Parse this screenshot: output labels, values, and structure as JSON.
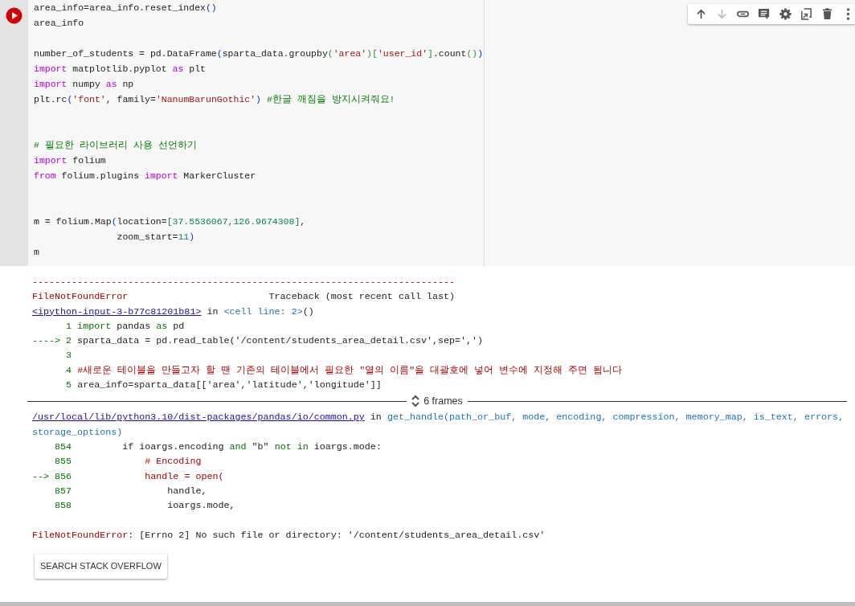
{
  "toolbar": [
    {
      "kind": "up",
      "disabled": false
    },
    {
      "kind": "down",
      "disabled": true
    },
    {
      "kind": "link",
      "disabled": false
    },
    {
      "kind": "comment",
      "disabled": false
    },
    {
      "kind": "settings",
      "disabled": false
    },
    {
      "kind": "mirror",
      "disabled": false
    },
    {
      "kind": "delete",
      "disabled": false
    },
    {
      "kind": "more",
      "disabled": false
    }
  ],
  "code_cell": {
    "lines": [
      {
        "kind": "code",
        "tokens": [
          {
            "text": "area_info=area_info.reset_index",
            "kind": "plain"
          },
          {
            "text": "()",
            "kind": "paren"
          }
        ]
      },
      {
        "kind": "code",
        "tokens": [
          {
            "text": "area_info",
            "kind": "plain"
          }
        ]
      },
      {
        "kind": "blank"
      },
      {
        "kind": "code",
        "tokens": [
          {
            "text": "number_of_students = pd.DataFrame",
            "kind": "plain"
          },
          {
            "text": "(",
            "kind": "paren"
          },
          {
            "text": "sparta_data.groupby",
            "kind": "plain"
          },
          {
            "text": "(",
            "kind": "paren2"
          },
          {
            "text": "'area'",
            "kind": "string"
          },
          {
            "text": ")[",
            "kind": "paren2"
          },
          {
            "text": "'user_id'",
            "kind": "string"
          },
          {
            "text": "]",
            "kind": "paren2"
          },
          {
            "text": ".count",
            "kind": "plain"
          },
          {
            "text": "()",
            "kind": "paren2"
          },
          {
            "text": ")",
            "kind": "paren"
          }
        ]
      },
      {
        "kind": "code",
        "tokens": [
          {
            "text": "import",
            "kind": "keyword"
          },
          {
            "text": " matplotlib.pyplot ",
            "kind": "plain"
          },
          {
            "text": "as",
            "kind": "keyword"
          },
          {
            "text": " plt",
            "kind": "plain"
          }
        ]
      },
      {
        "kind": "code",
        "tokens": [
          {
            "text": "import",
            "kind": "keyword"
          },
          {
            "text": " numpy ",
            "kind": "plain"
          },
          {
            "text": "as",
            "kind": "keyword"
          },
          {
            "text": " np",
            "kind": "plain"
          }
        ]
      },
      {
        "kind": "code",
        "tokens": [
          {
            "text": "plt.rc",
            "kind": "plain"
          },
          {
            "text": "(",
            "kind": "paren"
          },
          {
            "text": "'font'",
            "kind": "string"
          },
          {
            "text": ", family=",
            "kind": "plain"
          },
          {
            "text": "'NanumBarunGothic'",
            "kind": "string"
          },
          {
            "text": ")",
            "kind": "paren"
          },
          {
            "text": " #한글 깨짐을 방지시켜줘요!",
            "kind": "comment"
          }
        ]
      },
      {
        "kind": "blank"
      },
      {
        "kind": "blank"
      },
      {
        "kind": "code",
        "tokens": [
          {
            "text": "# 필요한 라이브러리 사용 선언하기",
            "kind": "comment"
          }
        ]
      },
      {
        "kind": "code",
        "tokens": [
          {
            "text": "import",
            "kind": "keyword"
          },
          {
            "text": " folium",
            "kind": "plain"
          }
        ]
      },
      {
        "kind": "code",
        "tokens": [
          {
            "text": "from",
            "kind": "keyword"
          },
          {
            "text": " folium.plugins ",
            "kind": "plain"
          },
          {
            "text": "import",
            "kind": "keyword"
          },
          {
            "text": " MarkerCluster",
            "kind": "plain"
          }
        ]
      },
      {
        "kind": "blank"
      },
      {
        "kind": "blank"
      },
      {
        "kind": "code",
        "tokens": [
          {
            "text": "m = folium.Map",
            "kind": "plain"
          },
          {
            "text": "(",
            "kind": "paren"
          },
          {
            "text": "location=",
            "kind": "plain"
          },
          {
            "text": "[37.5536067,126.9674308]",
            "kind": "number"
          },
          {
            "text": ",",
            "kind": "plain"
          }
        ]
      },
      {
        "kind": "code",
        "tokens": [
          {
            "text": "               zoom_start=",
            "kind": "plain"
          },
          {
            "text": "11",
            "kind": "number"
          },
          {
            "text": ")",
            "kind": "paren"
          }
        ]
      },
      {
        "kind": "code",
        "tokens": [
          {
            "text": "m",
            "kind": "plain"
          }
        ]
      }
    ]
  },
  "traceback": {
    "lines": [
      {
        "kind": "code",
        "tokens": [
          {
            "text": "---------------------------------------------------------------------------",
            "kind": "error"
          }
        ]
      },
      {
        "kind": "code",
        "tokens": [
          {
            "text": "FileNotFoundError",
            "kind": "error"
          },
          {
            "text": "                         Traceback (most recent call last)",
            "kind": "plain"
          }
        ]
      },
      {
        "kind": "code",
        "tokens": [
          {
            "text": "<ipython-input-3-b77c81201b81>",
            "kind": "link"
          },
          {
            "text": " in ",
            "kind": "plain"
          },
          {
            "text": "<cell line: 2>",
            "kind": "func"
          },
          {
            "text": "()",
            "kind": "plain"
          }
        ]
      },
      {
        "kind": "code",
        "tokens": [
          {
            "text": "      1 import",
            "kind": "lineno"
          },
          {
            "text": " pandas ",
            "kind": "plain"
          },
          {
            "text": "as",
            "kind": "lineno"
          },
          {
            "text": " pd",
            "kind": "plain"
          }
        ]
      },
      {
        "kind": "code",
        "tokens": [
          {
            "text": "----> 2 ",
            "kind": "lineno"
          },
          {
            "text": "sparta_data = pd.read_table('/content/students_area_detail.csv',sep=',')",
            "kind": "plain"
          }
        ]
      },
      {
        "kind": "code",
        "tokens": [
          {
            "text": "      3",
            "kind": "lineno"
          }
        ]
      },
      {
        "kind": "code",
        "tokens": [
          {
            "text": "      4 ",
            "kind": "lineno"
          },
          {
            "text": "#새로운 테이블을 만들고자 할 땐 기존의 테이블에서 필요한 \"열의 이름\"을 대괄호에 넣어 변수에 지정해 주면 됩니다",
            "kind": "error"
          }
        ]
      },
      {
        "kind": "code",
        "tokens": [
          {
            "text": "      5 ",
            "kind": "lineno"
          },
          {
            "text": "area_info=sparta_data[['area','latitude','longitude']]",
            "kind": "plain"
          }
        ]
      },
      {
        "kind": "frames",
        "label": "6 frames"
      },
      {
        "kind": "code",
        "tokens": [
          {
            "text": "/usr/local/lib/python3.10/dist-packages/pandas/io/common.py",
            "kind": "link"
          },
          {
            "text": " in ",
            "kind": "plain"
          },
          {
            "text": "get_handle(path_or_buf, mode, encoding, compression, memory_map, is_text, errors,",
            "kind": "func"
          }
        ]
      },
      {
        "kind": "code",
        "tokens": [
          {
            "text": "storage_options)",
            "kind": "func"
          }
        ]
      },
      {
        "kind": "code",
        "tokens": [
          {
            "text": "    854",
            "kind": "lineno"
          },
          {
            "text": "         if ioargs.encoding ",
            "kind": "plain"
          },
          {
            "text": "and",
            "kind": "lineno"
          },
          {
            "text": " \"b\" ",
            "kind": "plain"
          },
          {
            "text": "not in",
            "kind": "lineno"
          },
          {
            "text": " ioargs.mode:",
            "kind": "plain"
          }
        ]
      },
      {
        "kind": "code",
        "tokens": [
          {
            "text": "    855",
            "kind": "lineno"
          },
          {
            "text": "             # Encoding",
            "kind": "error"
          }
        ]
      },
      {
        "kind": "code",
        "tokens": [
          {
            "text": "--> 856",
            "kind": "lineno"
          },
          {
            "text": "             handle = open(",
            "kind": "error"
          }
        ]
      },
      {
        "kind": "code",
        "tokens": [
          {
            "text": "    857",
            "kind": "lineno"
          },
          {
            "text": "                 handle,",
            "kind": "plain"
          }
        ]
      },
      {
        "kind": "code",
        "tokens": [
          {
            "text": "    858",
            "kind": "lineno"
          },
          {
            "text": "                 ioargs.mode,",
            "kind": "plain"
          }
        ]
      },
      {
        "kind": "blank"
      },
      {
        "kind": "code",
        "tokens": [
          {
            "text": "FileNotFoundError",
            "kind": "error"
          },
          {
            "text": ": [Errno 2] No such file or directory: '/content/students_area_detail.csv'",
            "kind": "plain"
          }
        ]
      }
    ]
  },
  "search_button": "SEARCH STACK OVERFLOW"
}
